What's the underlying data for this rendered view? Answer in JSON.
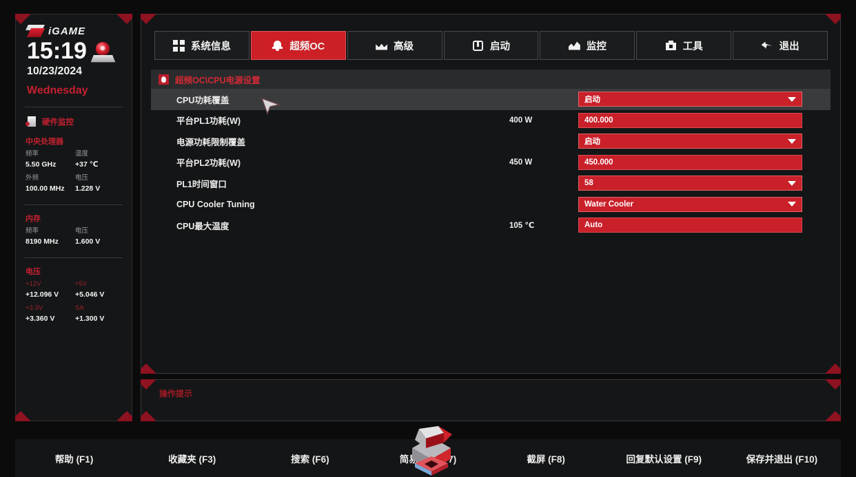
{
  "sidebar": {
    "brand": "iGAME",
    "clock": {
      "time": "15:19",
      "date": "10/23/2024",
      "day": "Wednesday"
    },
    "monitor_title": "硬件监控",
    "sections": [
      {
        "title": "中央处理器",
        "items": [
          {
            "key": "频率",
            "value": "5.50 GHz"
          },
          {
            "key": "温度",
            "value": "+37 ℃"
          },
          {
            "key": "外频",
            "value": "100.00 MHz"
          },
          {
            "key": "电压",
            "value": "1.228 V"
          }
        ]
      },
      {
        "title": "内存",
        "items": [
          {
            "key": "频率",
            "value": "8190 MHz"
          },
          {
            "key": "电压",
            "value": "1.600 V"
          }
        ]
      },
      {
        "title": "电压",
        "items": [
          {
            "key": "+12V",
            "value": "+12.096 V"
          },
          {
            "key": "+5V",
            "value": "+5.046 V"
          },
          {
            "key": "+3.3V",
            "value": "+3.360 V"
          },
          {
            "key": "SA",
            "value": "+1.300 V"
          }
        ]
      }
    ]
  },
  "tabs": [
    {
      "label": "系统信息",
      "icon": "grid-icon",
      "active": false
    },
    {
      "label": "超频OC",
      "icon": "bell-icon",
      "active": true
    },
    {
      "label": "高级",
      "icon": "crown-icon",
      "active": false
    },
    {
      "label": "启动",
      "icon": "power-icon",
      "active": false
    },
    {
      "label": "监控",
      "icon": "wave-icon",
      "active": false
    },
    {
      "label": "工具",
      "icon": "toolbox-icon",
      "active": false
    },
    {
      "label": "退出",
      "icon": "back-arrow-icon",
      "active": false
    }
  ],
  "breadcrumb": "超频OC\\CPU电源设置",
  "settings": [
    {
      "label": "CPU功耗覆盖",
      "aux": "",
      "value": "启动",
      "control": "dropdown",
      "selected": true
    },
    {
      "label": "平台PL1功耗(W)",
      "aux": "400 W",
      "value": "400.000",
      "control": "input",
      "selected": false
    },
    {
      "label": "电源功耗限制覆盖",
      "aux": "",
      "value": "启动",
      "control": "dropdown",
      "selected": false
    },
    {
      "label": "平台PL2功耗(W)",
      "aux": "450 W",
      "value": "450.000",
      "control": "input",
      "selected": false
    },
    {
      "label": "PL1时间窗口",
      "aux": "",
      "value": "58",
      "control": "dropdown",
      "selected": false
    },
    {
      "label": "CPU Cooler Tuning",
      "aux": "",
      "value": "Water Cooler",
      "control": "dropdown",
      "selected": false
    },
    {
      "label": "CPU最大温度",
      "aux": "105 ℃",
      "value": "Auto",
      "control": "input",
      "selected": false
    }
  ],
  "hint": {
    "title": "操作提示",
    "body": ""
  },
  "footer": [
    "帮助 (F1)",
    "收藏夹 (F3)",
    "搜索 (F6)",
    "简易模式 (F7)",
    "截屏 (F8)",
    "回复默认设置 (F9)",
    "保存并退出 (F10)"
  ],
  "colors": {
    "accent": "#c9202a",
    "accent_text": "#c42030",
    "panel": "#141516",
    "selected_row": "#3a3b3d"
  }
}
